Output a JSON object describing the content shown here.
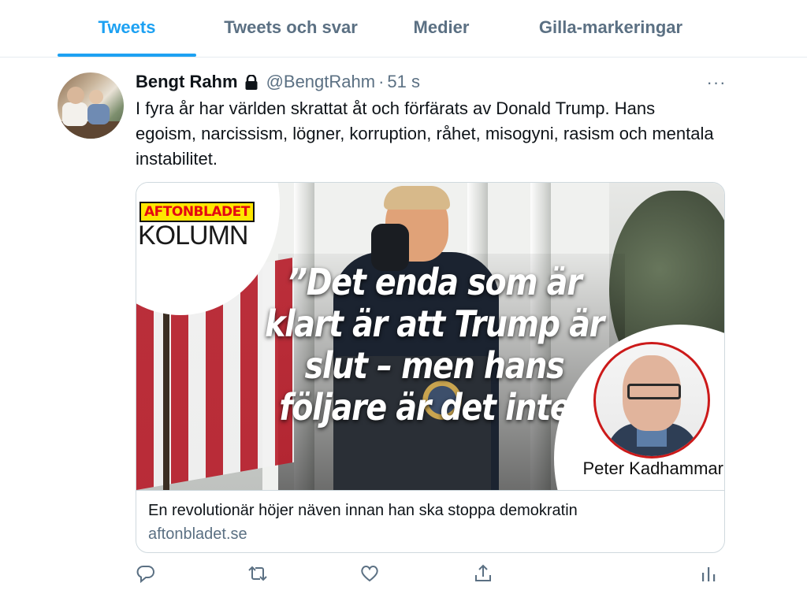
{
  "tabs": [
    {
      "label": "Tweets",
      "active": true
    },
    {
      "label": "Tweets och svar",
      "active": false
    },
    {
      "label": "Medier",
      "active": false
    },
    {
      "label": "Gilla-markeringar",
      "active": false
    }
  ],
  "tweet": {
    "name": "Bengt Rahm",
    "handle": "@BengtRahm",
    "separator": "·",
    "time": "51 s",
    "more_label": "···",
    "text": "I fyra år har världen skrattat åt och förfärats av Donald Trump. Hans egoism, narcissism, lögner, korruption, råhet, misogyni, rasism och mentala instabilitet.",
    "card": {
      "logo_text": "AFTONBLADET",
      "section": "KOLUMN",
      "quote": "”Det enda som är klart är att Trump är slut – men hans följare är det inte”",
      "author": "Peter Kadhammar",
      "title": "En revolutionär höjer näven innan han ska stoppa demokratin",
      "domain": "aftonbladet.se"
    },
    "actions": [
      "reply-icon",
      "retweet-icon",
      "like-icon",
      "share-icon",
      "analytics-icon"
    ]
  },
  "colors": {
    "accent": "#1da1f2",
    "secondary_text": "#5b7083",
    "border": "#cfd9de"
  }
}
